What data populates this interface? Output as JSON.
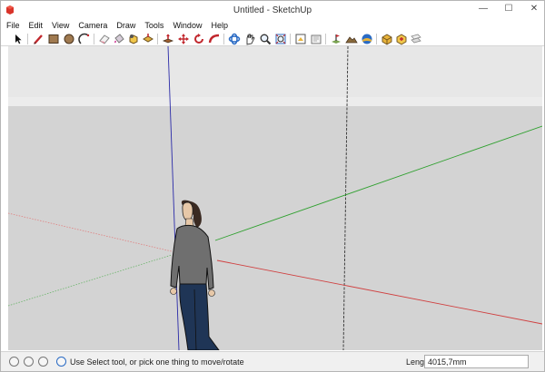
{
  "window": {
    "title": "Untitled - SketchUp",
    "controls": {
      "minimize": "—",
      "maximize": "☐",
      "close": "✕"
    }
  },
  "menu": [
    "File",
    "Edit",
    "View",
    "Camera",
    "Draw",
    "Tools",
    "Window",
    "Help"
  ],
  "toolbar": [
    "select-tool",
    "pencil-line-tool",
    "rectangle-tool",
    "circle-tool",
    "arc-tool",
    "eraser-tool",
    "paint-bucket-tool",
    "make-component-tool",
    "push-pull-tool",
    "move-tool",
    "rotate-tool",
    "follow-me-tool",
    "orbit-tool",
    "pan-tool",
    "zoom-tool",
    "zoom-extents-tool",
    "get-models-tool",
    "share-model-tool",
    "add-location-tool",
    "toggle-terrain-tool",
    "3d-warehouse-tool",
    "extension-warehouse-tool",
    "share-component-tool",
    "layout-tool"
  ],
  "viewport": {
    "colors": {
      "sky": "#e6e6e6",
      "ground": "#d3d3d3",
      "red_axis": "#d04040",
      "green_axis": "#2fa02f",
      "blue_axis": "#2a2aa8"
    },
    "figure": "person-figure"
  },
  "status": {
    "icons": [
      "geo-location-icon",
      "credits-icon",
      "user-icon"
    ],
    "help_icon": "help-icon",
    "text": "Use Select tool, or pick one thing to move/rotate",
    "length_label": "Length",
    "length_value": "4015,7mm"
  }
}
